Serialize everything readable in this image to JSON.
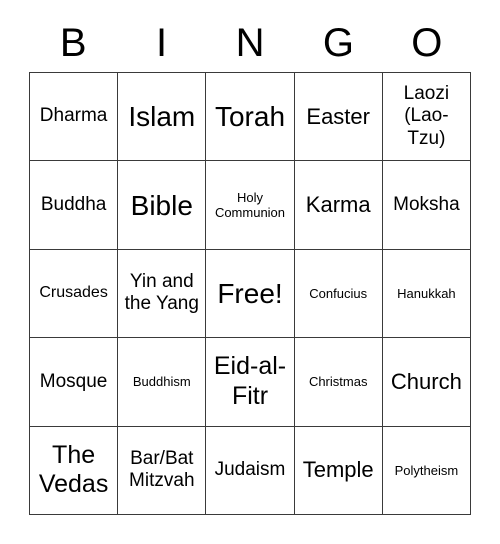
{
  "card": {
    "title": "BINGO",
    "header_letters": [
      "B",
      "I",
      "N",
      "G",
      "O"
    ],
    "free_space": "Free!",
    "border_color": "#3a3a3a",
    "background_color": "#ffffff",
    "text_color": "#000000",
    "rows": [
      [
        {
          "text": "Dharma",
          "size": "sz-m"
        },
        {
          "text": "Islam",
          "size": "sz-xxl"
        },
        {
          "text": "Torah",
          "size": "sz-xxl"
        },
        {
          "text": "Easter",
          "size": "sz-l"
        },
        {
          "text": "Laozi (Lao-Tzu)",
          "size": "sz-m"
        }
      ],
      [
        {
          "text": "Buddha",
          "size": "sz-m"
        },
        {
          "text": "Bible",
          "size": "sz-xxl"
        },
        {
          "text": "Holy Communion",
          "size": "sz-xs"
        },
        {
          "text": "Karma",
          "size": "sz-l"
        },
        {
          "text": "Moksha",
          "size": "sz-m"
        }
      ],
      [
        {
          "text": "Crusades",
          "size": "sz-s"
        },
        {
          "text": "Yin and the Yang",
          "size": "sz-m"
        },
        {
          "text": "Free!",
          "size": "sz-xxl"
        },
        {
          "text": "Confucius",
          "size": "sz-xs"
        },
        {
          "text": "Hanukkah",
          "size": "sz-xs"
        }
      ],
      [
        {
          "text": "Mosque",
          "size": "sz-m"
        },
        {
          "text": "Buddhism",
          "size": "sz-xs"
        },
        {
          "text": "Eid-al-Fitr",
          "size": "sz-xl"
        },
        {
          "text": "Christmas",
          "size": "sz-xs"
        },
        {
          "text": "Church",
          "size": "sz-l"
        }
      ],
      [
        {
          "text": "The Vedas",
          "size": "sz-xl"
        },
        {
          "text": "Bar/Bat Mitzvah",
          "size": "sz-m"
        },
        {
          "text": "Judaism",
          "size": "sz-m"
        },
        {
          "text": "Temple",
          "size": "sz-l"
        },
        {
          "text": "Polytheism",
          "size": "sz-xs"
        }
      ]
    ]
  }
}
